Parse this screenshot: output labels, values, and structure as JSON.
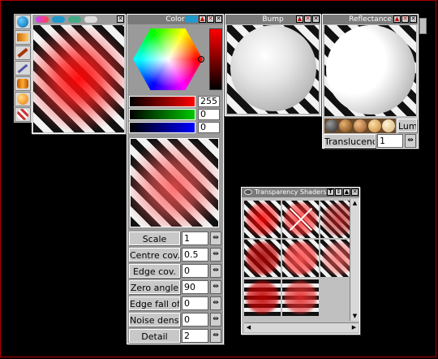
{
  "color_panel": {
    "title": "Color",
    "red_value": "255",
    "green_value": "0",
    "blue_value": "0",
    "params": [
      {
        "label": "Scale",
        "value": "1"
      },
      {
        "label": "Centre cov.",
        "value": "0.5"
      },
      {
        "label": "Edge cov.",
        "value": "0"
      },
      {
        "label": "Zero angle",
        "value": "90"
      },
      {
        "label": "Edge fall off",
        "value": "0"
      },
      {
        "label": "Noise density",
        "value": "0"
      },
      {
        "label": "Detail",
        "value": "2"
      }
    ]
  },
  "bump_panel": {
    "title": "Bump"
  },
  "reflectance_panel": {
    "title": "Reflectance",
    "lum_label": "Lum",
    "translucency_label": "Translucency",
    "translucency_value": "1"
  },
  "transparency_panel": {
    "title": "Transparency Shaders",
    "tool_letter": "T"
  },
  "colors": {
    "accent_red": "#ff0000",
    "panel_gray": "#c0c0c0",
    "title_gray": "#7a7a7a"
  }
}
